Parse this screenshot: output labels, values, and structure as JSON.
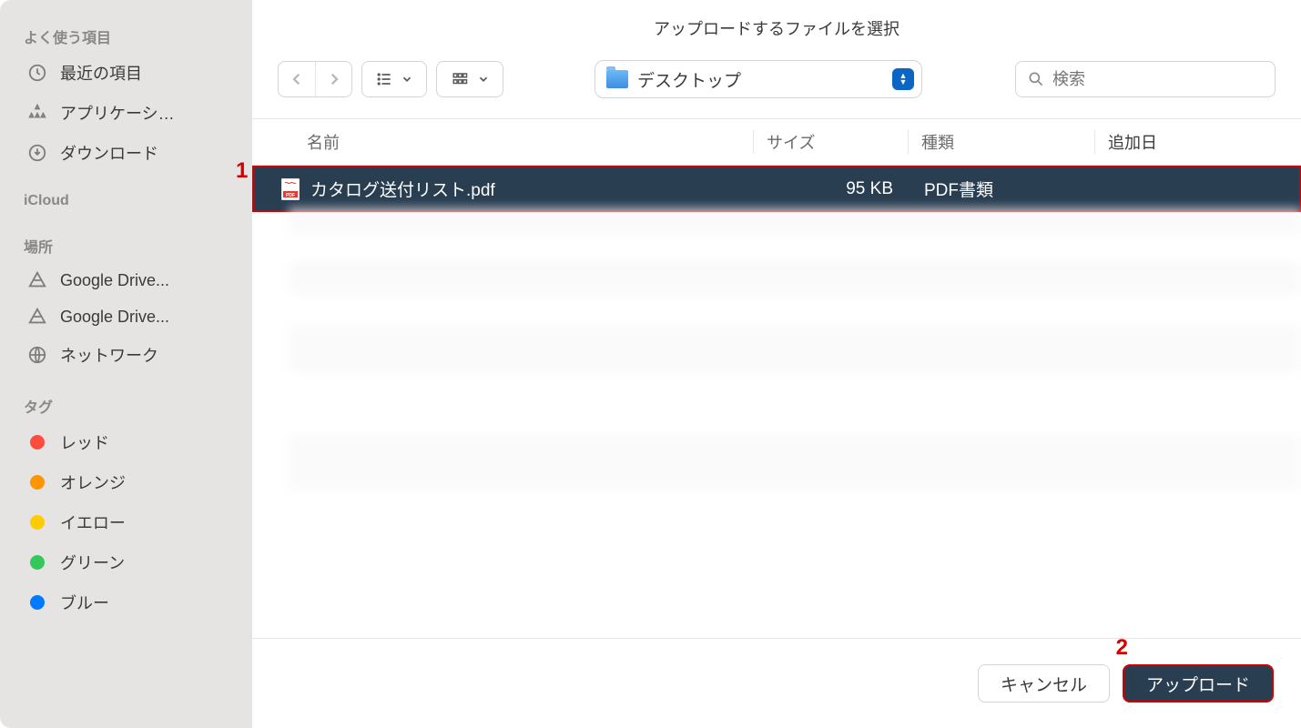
{
  "window_title": "アップロードするファイルを選択",
  "sidebar": {
    "favorites_label": "よく使う項目",
    "favorites": [
      {
        "label": "最近の項目",
        "icon": "clock"
      },
      {
        "label": "アプリケーシ…",
        "icon": "apps"
      },
      {
        "label": "ダウンロード",
        "icon": "download"
      }
    ],
    "icloud_label": "iCloud",
    "locations_label": "場所",
    "locations": [
      {
        "label": "Google Drive...",
        "icon": "gdrive"
      },
      {
        "label": "Google Drive...",
        "icon": "gdrive"
      },
      {
        "label": "ネットワーク",
        "icon": "network"
      }
    ],
    "tags_label": "タグ",
    "tags": [
      {
        "label": "レッド",
        "color": "#ff4b40"
      },
      {
        "label": "オレンジ",
        "color": "#ff9500"
      },
      {
        "label": "イエロー",
        "color": "#ffcc00"
      },
      {
        "label": "グリーン",
        "color": "#34c759"
      },
      {
        "label": "ブルー",
        "color": "#007aff"
      }
    ]
  },
  "toolbar": {
    "current_folder": "デスクトップ",
    "search_placeholder": "検索"
  },
  "columns": {
    "name": "名前",
    "size": "サイズ",
    "kind": "種類",
    "date_added": "追加日"
  },
  "files": [
    {
      "name": "カタログ送付リスト.pdf",
      "size": "95 KB",
      "kind": "PDF書類",
      "date_added": "",
      "selected": true
    }
  ],
  "footer": {
    "cancel": "キャンセル",
    "upload": "アップロード"
  },
  "annotations": {
    "row": "1",
    "button": "2"
  }
}
